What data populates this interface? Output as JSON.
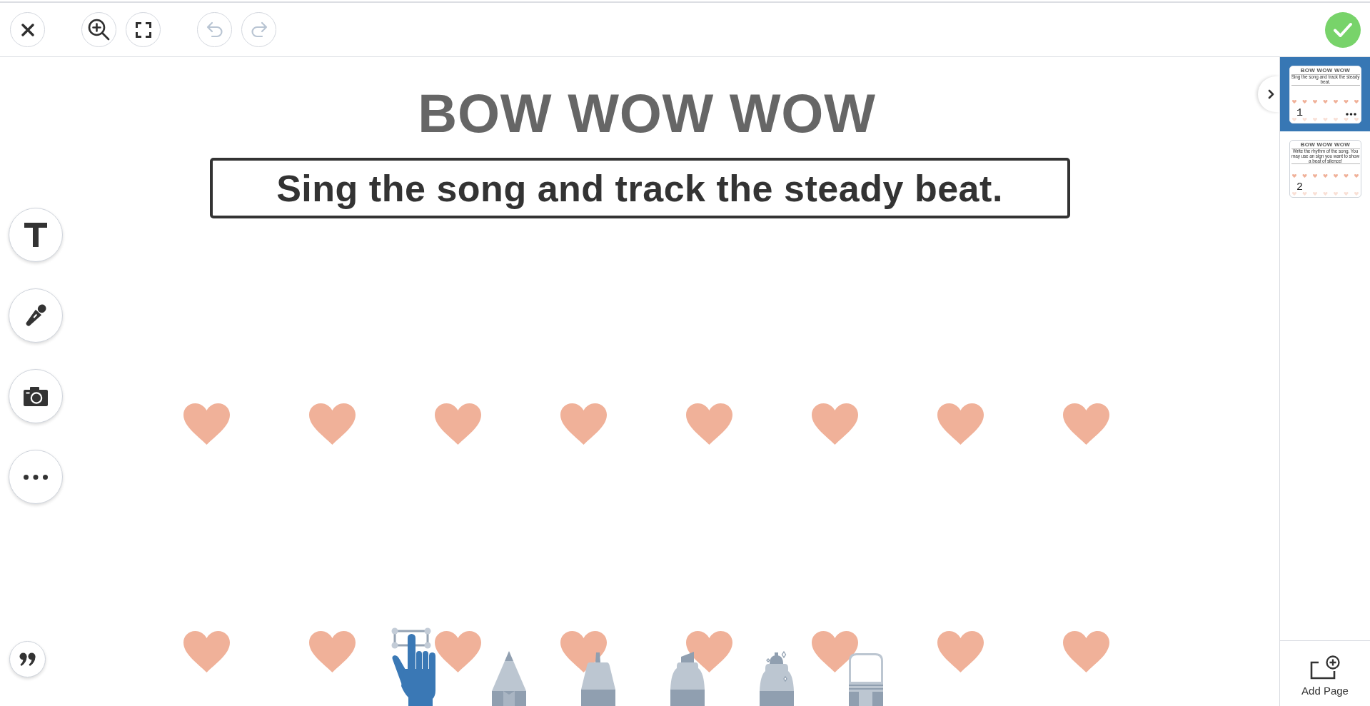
{
  "top_bar": {
    "button_groups": [
      {
        "buttons": [
          {
            "kind": "close",
            "disabled": false
          }
        ]
      },
      {
        "buttons": [
          {
            "kind": "zoom_in",
            "disabled": false
          },
          {
            "kind": "fullscreen",
            "disabled": false
          }
        ]
      },
      {
        "buttons": [
          {
            "kind": "undo",
            "disabled": true
          },
          {
            "kind": "redo",
            "disabled": true
          }
        ]
      }
    ]
  },
  "page": {
    "title": "BOW WOW WOW",
    "instruction": "Sing the song and track the steady beat."
  },
  "side_tools": [
    {
      "kind": "text"
    },
    {
      "kind": "microphone"
    },
    {
      "kind": "camera"
    },
    {
      "kind": "more"
    }
  ],
  "drawing_tools": [
    {
      "kind": "hand",
      "selected": true
    },
    {
      "kind": "pencil",
      "selected": false
    },
    {
      "kind": "marker",
      "selected": false
    },
    {
      "kind": "highlighter",
      "selected": false
    },
    {
      "kind": "glitter",
      "selected": false
    },
    {
      "kind": "eraser",
      "selected": false
    }
  ],
  "pages_panel": {
    "pages": [
      {
        "number": "1",
        "title": "BOW WOW WOW",
        "instruction": "Sing the song and track the steady beat.",
        "selected": true
      },
      {
        "number": "2",
        "title": "BOW WOW WOW",
        "instruction": "Write the rhythm of the song. You may use an sign you want to show a beat of silence!",
        "selected": false
      }
    ],
    "add_page": "Add Page"
  }
}
